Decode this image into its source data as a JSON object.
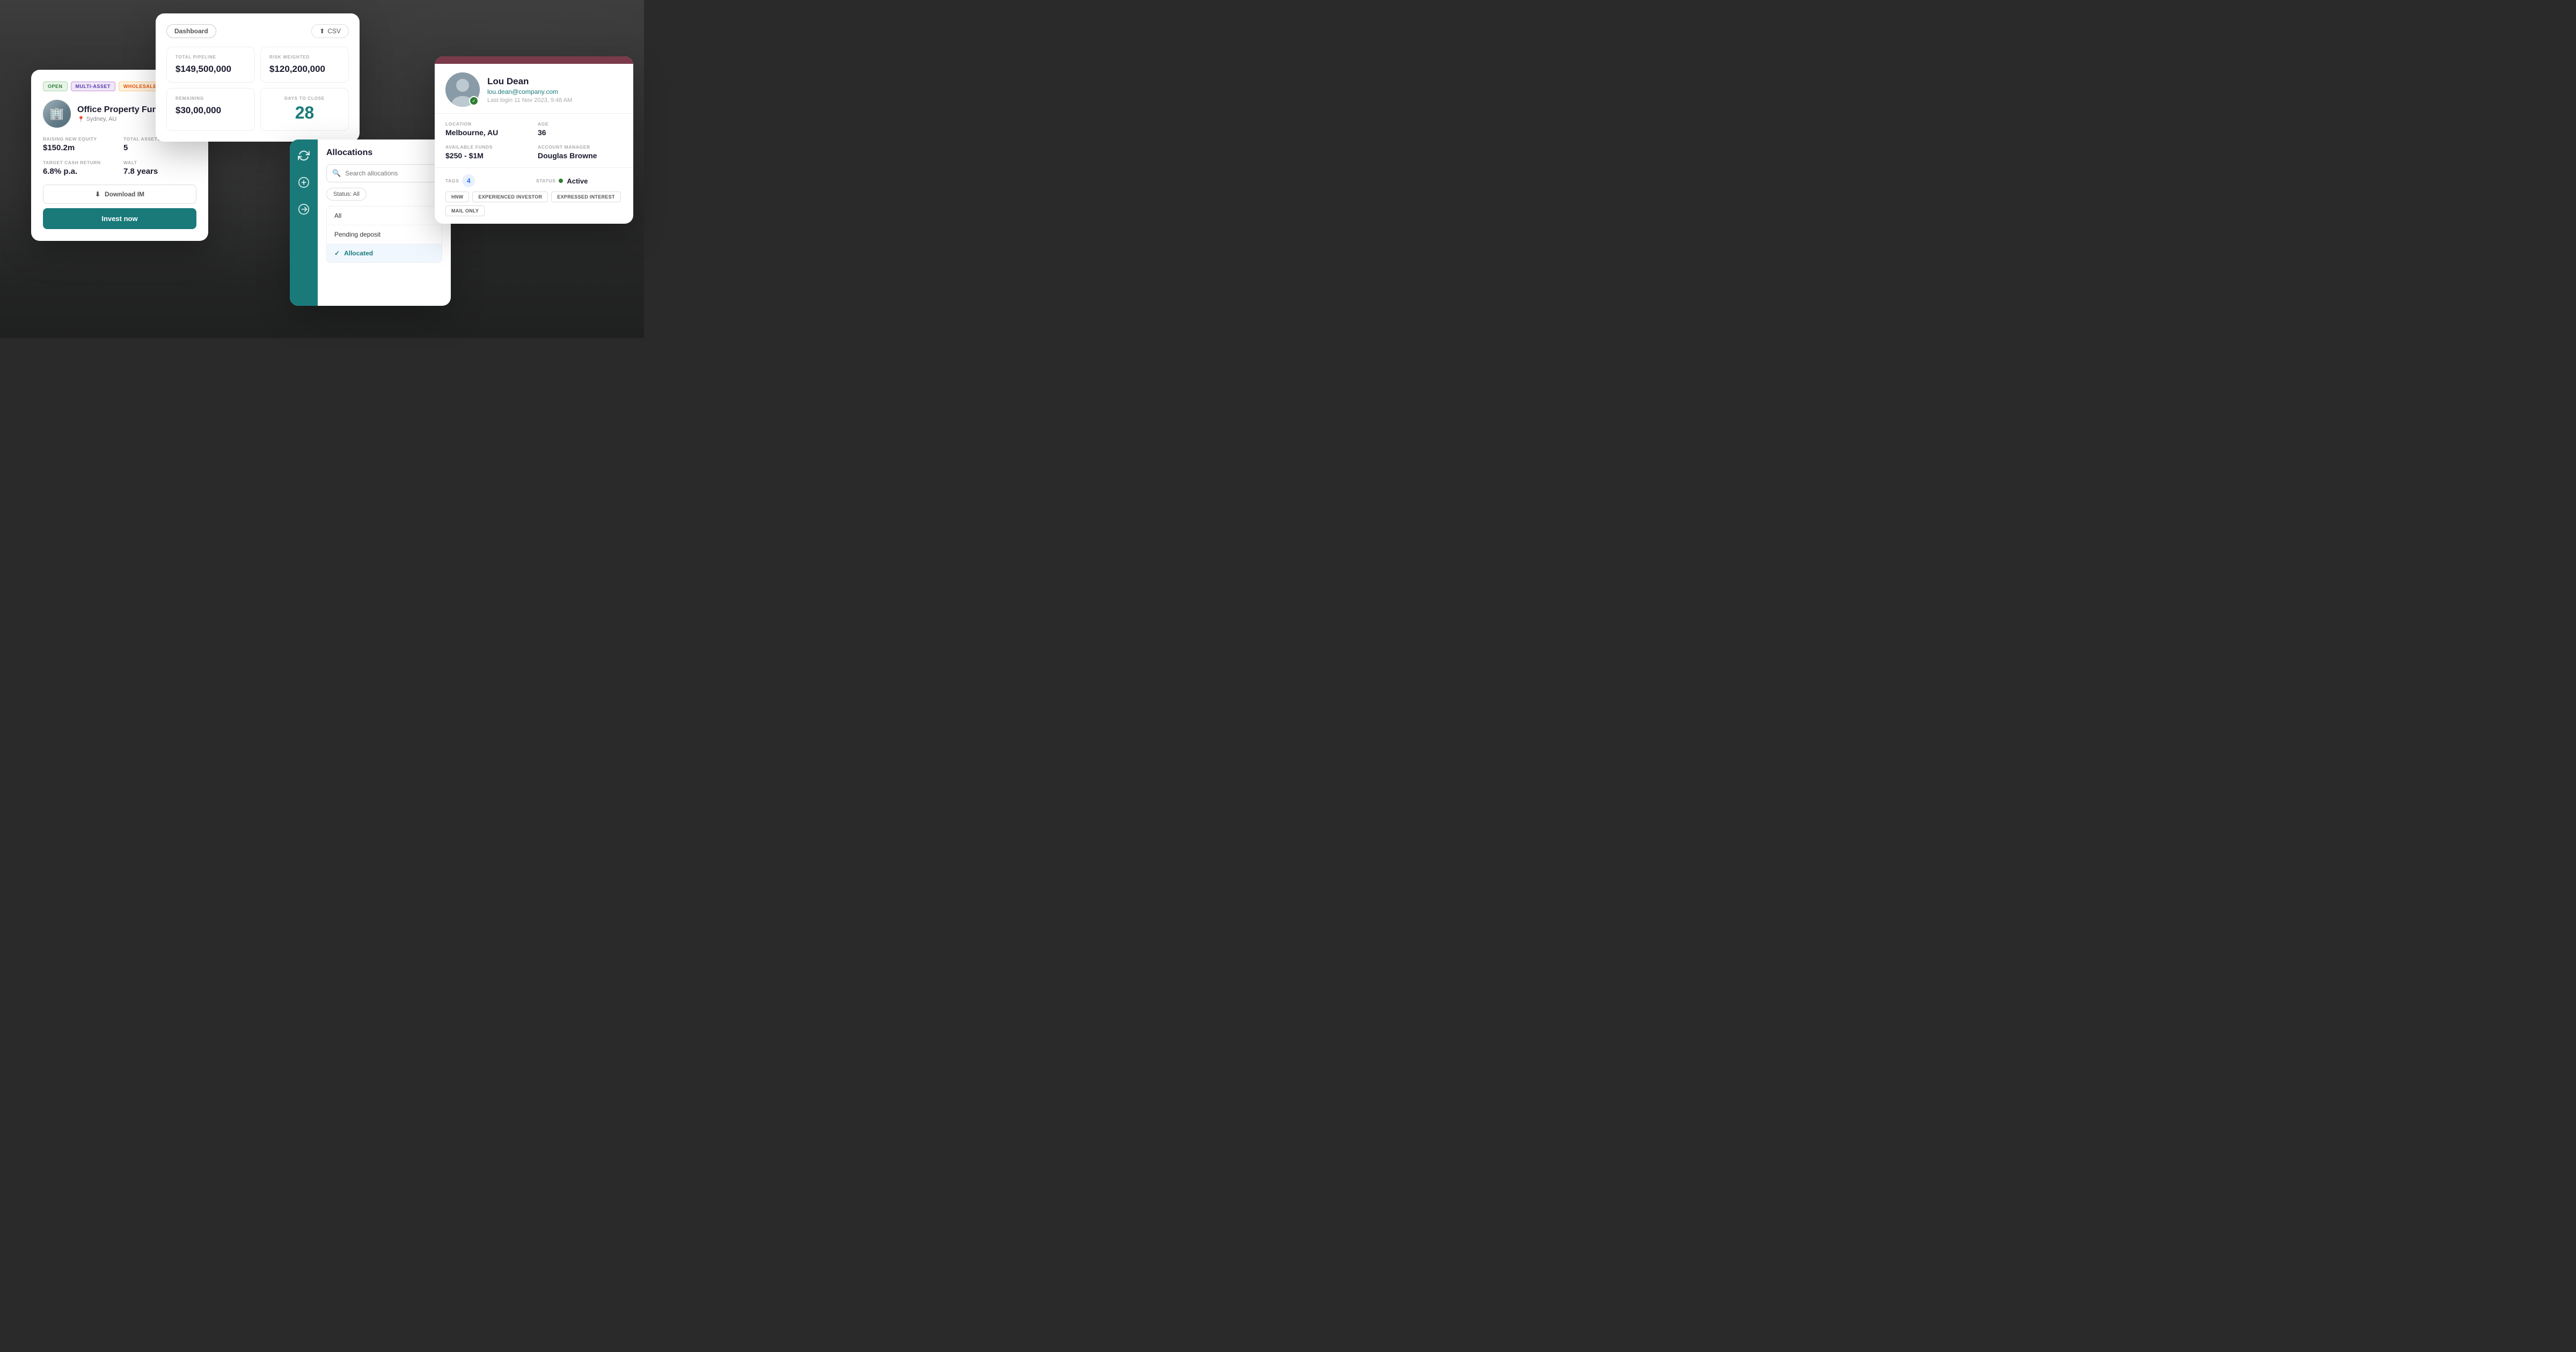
{
  "background": {
    "description": "Office meeting room background"
  },
  "fund_card": {
    "badges": {
      "open": "OPEN",
      "multi": "MULTI-ASSET",
      "wholesale": "WHOLESALE"
    },
    "name": "Office Property Fund",
    "location": "Sydney, AU",
    "stats": {
      "raising_label": "RAISING NEW EQUITY",
      "raising_value": "$150.2m",
      "total_assets_label": "TOTAL ASSETS",
      "total_assets_value": "5",
      "cash_return_label": "TARGET CASH RETURN",
      "cash_return_value": "6.8% p.a.",
      "walt_label": "WALT",
      "walt_value": "7.8 years"
    },
    "btn_download": "Download IM",
    "btn_invest": "Invest now"
  },
  "dashboard_card": {
    "tab_label": "Dashboard",
    "csv_label": "CSV",
    "metrics": {
      "total_pipeline_label": "TOTAL PIPELINE",
      "total_pipeline_value": "$149,500,000",
      "risk_weighted_label": "RISK WEIGHTED",
      "risk_weighted_value": "$120,200,000",
      "remaining_label": "REMAINING",
      "remaining_value": "$30,00,000",
      "days_to_close_label": "DAYS TO CLOSE",
      "days_to_close_value": "28"
    }
  },
  "allocations_card": {
    "title": "Allocations",
    "search_placeholder": "Search allocations",
    "filter_label": "Status: All",
    "items": [
      {
        "label": "All",
        "active": false
      },
      {
        "label": "Pending deposit",
        "active": false
      },
      {
        "label": "Allocated",
        "active": true
      }
    ],
    "check_icon": "✓"
  },
  "profile_card": {
    "name": "Lou Dean",
    "email": "lou.dean@company.com",
    "last_login": "Last login 11 Nov 2023, 9:48 AM",
    "location_label": "LOCATION",
    "location_value": "Melbourne, AU",
    "age_label": "AGE",
    "age_value": "36",
    "funds_label": "AVAILABLE FUNDS",
    "funds_value": "$250 - $1M",
    "manager_label": "ACCOUNT MANAGER",
    "manager_value": "Douglas Browne",
    "tags_label": "TAGS",
    "tags_count": "4",
    "status_label": "STATUS",
    "status_value": "Active",
    "chips": {
      "hnw": "HNW",
      "experienced": "EXPERIENCED INVESTOR",
      "interest": "EXPRESSED INTEREST",
      "mail": "MAIL ONLY"
    }
  }
}
